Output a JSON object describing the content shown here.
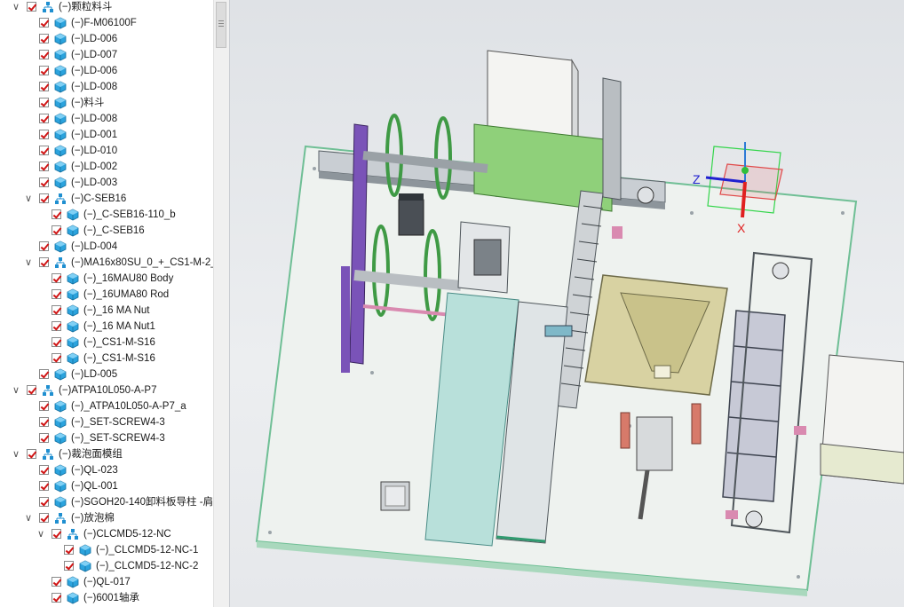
{
  "tree": {
    "items": [
      {
        "label": "(−)颗粒料斗",
        "level": 1,
        "kind": "assembly",
        "expanded": true
      },
      {
        "label": "(−)F-M06100F",
        "level": 2,
        "kind": "part"
      },
      {
        "label": "(−)LD-006",
        "level": 2,
        "kind": "part"
      },
      {
        "label": "(−)LD-007",
        "level": 2,
        "kind": "part"
      },
      {
        "label": "(−)LD-006",
        "level": 2,
        "kind": "part"
      },
      {
        "label": "(−)LD-008",
        "level": 2,
        "kind": "part"
      },
      {
        "label": "(−)料斗",
        "level": 2,
        "kind": "part"
      },
      {
        "label": "(−)LD-008",
        "level": 2,
        "kind": "part"
      },
      {
        "label": "(−)LD-001",
        "level": 2,
        "kind": "part"
      },
      {
        "label": "(−)LD-010",
        "level": 2,
        "kind": "part"
      },
      {
        "label": "(−)LD-002",
        "level": 2,
        "kind": "part"
      },
      {
        "label": "(−)LD-003",
        "level": 2,
        "kind": "part"
      },
      {
        "label": "(−)C-SEB16",
        "level": 2,
        "kind": "assembly",
        "expanded": true
      },
      {
        "label": "(−)_C-SEB16-110_b",
        "level": 3,
        "kind": "part"
      },
      {
        "label": "(−)_C-SEB16",
        "level": 3,
        "kind": "part"
      },
      {
        "label": "(−)LD-004",
        "level": 2,
        "kind": "part"
      },
      {
        "label": "(−)MA16x80SU_0_+_CS1-M-2_",
        "level": 2,
        "kind": "assembly",
        "expanded": true
      },
      {
        "label": "(−)_16MAU80 Body",
        "level": 3,
        "kind": "part"
      },
      {
        "label": "(−)_16UMA80 Rod",
        "level": 3,
        "kind": "part"
      },
      {
        "label": "(−)_16 MA Nut",
        "level": 3,
        "kind": "part"
      },
      {
        "label": "(−)_16 MA Nut1",
        "level": 3,
        "kind": "part"
      },
      {
        "label": "(−)_CS1-M-S16",
        "level": 3,
        "kind": "part"
      },
      {
        "label": "(−)_CS1-M-S16",
        "level": 3,
        "kind": "part"
      },
      {
        "label": "(−)LD-005",
        "level": 2,
        "kind": "part"
      },
      {
        "label": "(−)ATPA10L050-A-P7",
        "level": 1,
        "kind": "assembly",
        "expanded": true
      },
      {
        "label": "(−)_ATPA10L050-A-P7_a",
        "level": 2,
        "kind": "part"
      },
      {
        "label": "(−)_SET-SCREW4-3",
        "level": 2,
        "kind": "part"
      },
      {
        "label": "(−)_SET-SCREW4-3",
        "level": 2,
        "kind": "part"
      },
      {
        "label": "(−)裁泡面模组",
        "level": 1,
        "kind": "assembly",
        "expanded": true
      },
      {
        "label": "(−)QL-023",
        "level": 2,
        "kind": "part"
      },
      {
        "label": "(−)QL-001",
        "level": 2,
        "kind": "part"
      },
      {
        "label": "(−)SGOH20-140卸料板导柱 -肩",
        "level": 2,
        "kind": "part"
      },
      {
        "label": "(−)放泡棉",
        "level": 2,
        "kind": "assembly",
        "expanded": true
      },
      {
        "label": "(−)CLCMD5-12-NC",
        "level": 3,
        "kind": "assembly",
        "expanded": true
      },
      {
        "label": "(−)_CLCMD5-12-NC-1",
        "level": 4,
        "kind": "part"
      },
      {
        "label": "(−)_CLCMD5-12-NC-2",
        "level": 4,
        "kind": "part"
      },
      {
        "label": "(−)QL-017",
        "level": 3,
        "kind": "part"
      },
      {
        "label": "(−)6001轴承",
        "level": 3,
        "kind": "part"
      }
    ]
  },
  "triad": {
    "z_label": "Z",
    "x_label": "X"
  },
  "colors": {
    "plate": "#eef2ef",
    "plate_edge": "#7fc7a0",
    "green_panel": "#8fd07a",
    "hopper": "#d8d2a2",
    "purple": "#7a53b8",
    "pink": "#d98ab0",
    "belt": "#b8e0da",
    "salmon": "#d77a6a",
    "accent_blue": "#1f8fd0"
  }
}
